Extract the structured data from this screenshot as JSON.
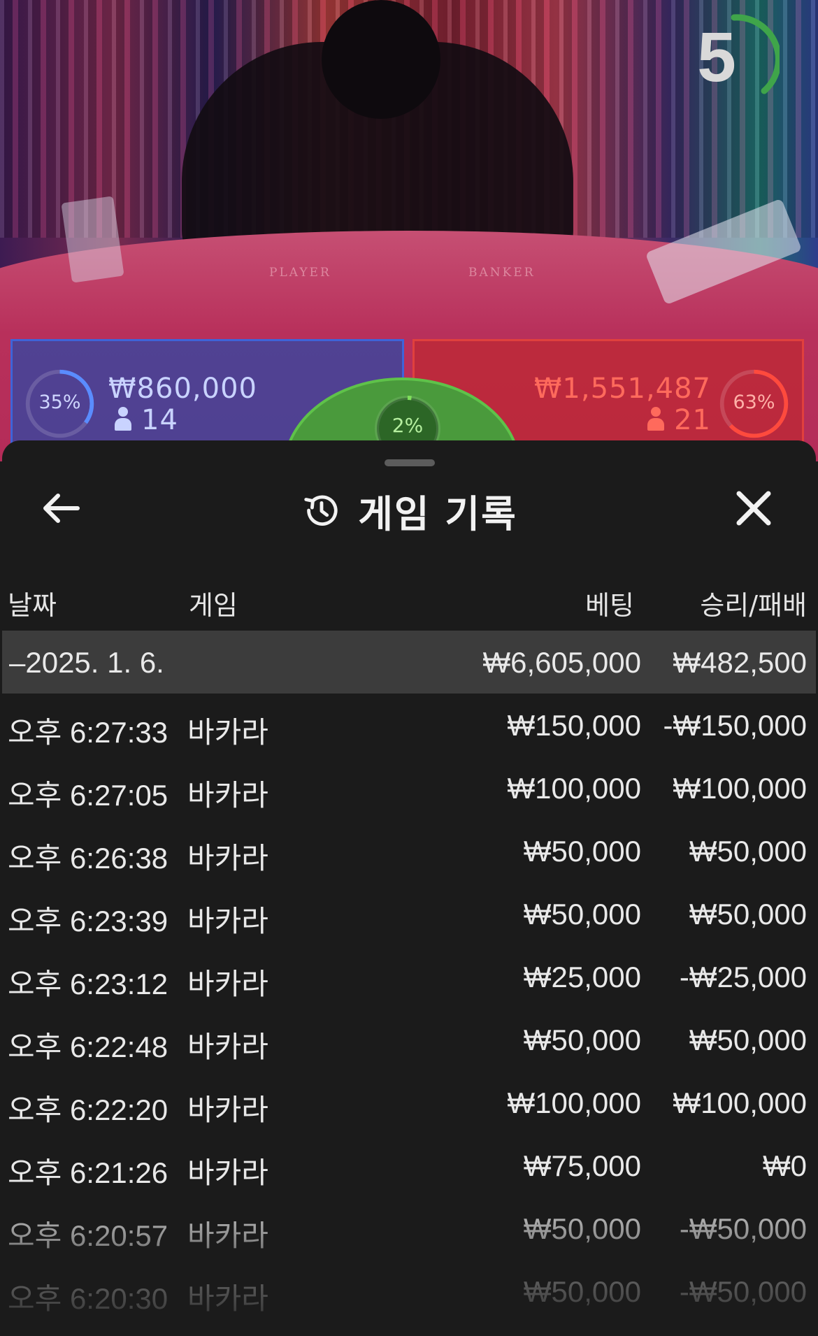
{
  "video": {
    "countdown": "5",
    "felt_labels": {
      "player": "PLAYER",
      "banker": "BANKER"
    },
    "player": {
      "percent": "35%",
      "percent_value": 0.35,
      "amount": "₩860,000",
      "players": "14",
      "color": "#3f63d8"
    },
    "banker": {
      "percent": "63%",
      "percent_value": 0.63,
      "amount": "₩1,551,487",
      "players": "21",
      "color": "#e0403d"
    },
    "tie": {
      "percent": "2%",
      "percent_value": 0.02,
      "color": "#5fc24a"
    }
  },
  "sheet": {
    "title": "게임 기록",
    "back_icon": "arrow-left-icon",
    "history_icon": "history-icon",
    "close_icon": "close-icon",
    "columns": {
      "date": "날짜",
      "game": "게임",
      "bet": "베팅",
      "result": "승리/패배"
    },
    "date_group": {
      "label": "–2025. 1. 6.",
      "bet_total": "₩6,605,000",
      "result_total": "₩482,500"
    },
    "rows": [
      {
        "time": "오후 6:27:33",
        "game": "바카라",
        "bet": "₩150,000",
        "result": "-₩150,000"
      },
      {
        "time": "오후 6:27:05",
        "game": "바카라",
        "bet": "₩100,000",
        "result": "₩100,000"
      },
      {
        "time": "오후 6:26:38",
        "game": "바카라",
        "bet": "₩50,000",
        "result": "₩50,000"
      },
      {
        "time": "오후 6:23:39",
        "game": "바카라",
        "bet": "₩50,000",
        "result": "₩50,000"
      },
      {
        "time": "오후 6:23:12",
        "game": "바카라",
        "bet": "₩25,000",
        "result": "-₩25,000"
      },
      {
        "time": "오후 6:22:48",
        "game": "바카라",
        "bet": "₩50,000",
        "result": "₩50,000"
      },
      {
        "time": "오후 6:22:20",
        "game": "바카라",
        "bet": "₩100,000",
        "result": "₩100,000"
      },
      {
        "time": "오후 6:21:26",
        "game": "바카라",
        "bet": "₩75,000",
        "result": "₩0"
      },
      {
        "time": "오후 6:20:57",
        "game": "바카라",
        "bet": "₩50,000",
        "result": "-₩50,000"
      },
      {
        "time": "오후 6:20:30",
        "game": "바카라",
        "bet": "₩50,000",
        "result": "-₩50,000"
      }
    ]
  }
}
